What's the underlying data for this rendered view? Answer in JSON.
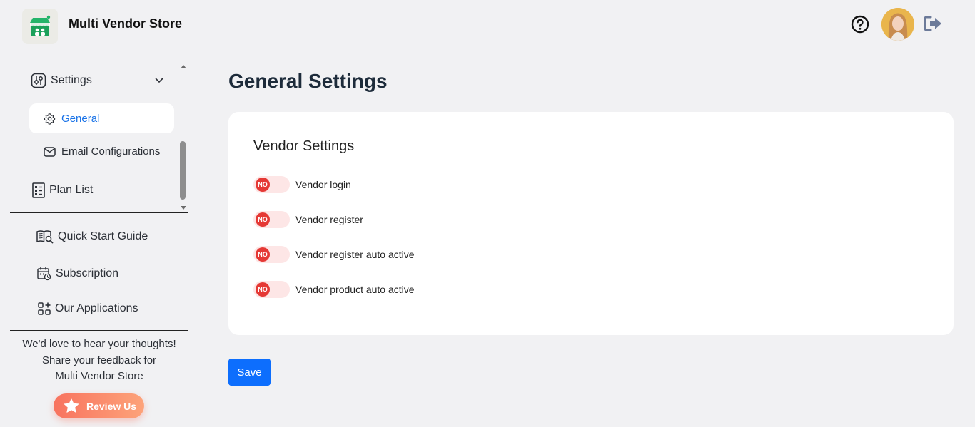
{
  "header": {
    "app_title": "Multi Vendor Store",
    "icons": [
      "store-logo-icon",
      "help-icon",
      "avatar",
      "logout-icon"
    ]
  },
  "sidebar": {
    "settings_label": "Settings",
    "sub_items": [
      {
        "label": "General",
        "icon": "gear-icon",
        "active": true
      },
      {
        "label": "Email Configurations",
        "icon": "mail-icon",
        "active": false
      }
    ],
    "plan_list_label": "Plan List",
    "bottom_items": [
      {
        "label": "Quick Start Guide",
        "icon": "book-search-icon"
      },
      {
        "label": "Subscription",
        "icon": "calendar-clock-icon"
      },
      {
        "label": "Our Applications",
        "icon": "apps-icon"
      }
    ],
    "feedback_lines": [
      "We'd love to hear your thoughts!",
      "Share your feedback for",
      "Multi Vendor Store"
    ],
    "review_label": "Review Us"
  },
  "main": {
    "title": "General Settings",
    "card_title": "Vendor Settings",
    "toggles": [
      {
        "label": "Vendor login",
        "state": "NO"
      },
      {
        "label": "Vendor register",
        "state": "NO"
      },
      {
        "label": "Vendor register auto active",
        "state": "NO"
      },
      {
        "label": "Vendor product auto active",
        "state": "NO"
      }
    ],
    "save_label": "Save"
  },
  "colors": {
    "accent": "#0d6efd",
    "active_link": "#1a73e8",
    "toggle_off": "#e53935",
    "review_gradient_start": "#f8735f",
    "review_gradient_end": "#fda37a"
  }
}
